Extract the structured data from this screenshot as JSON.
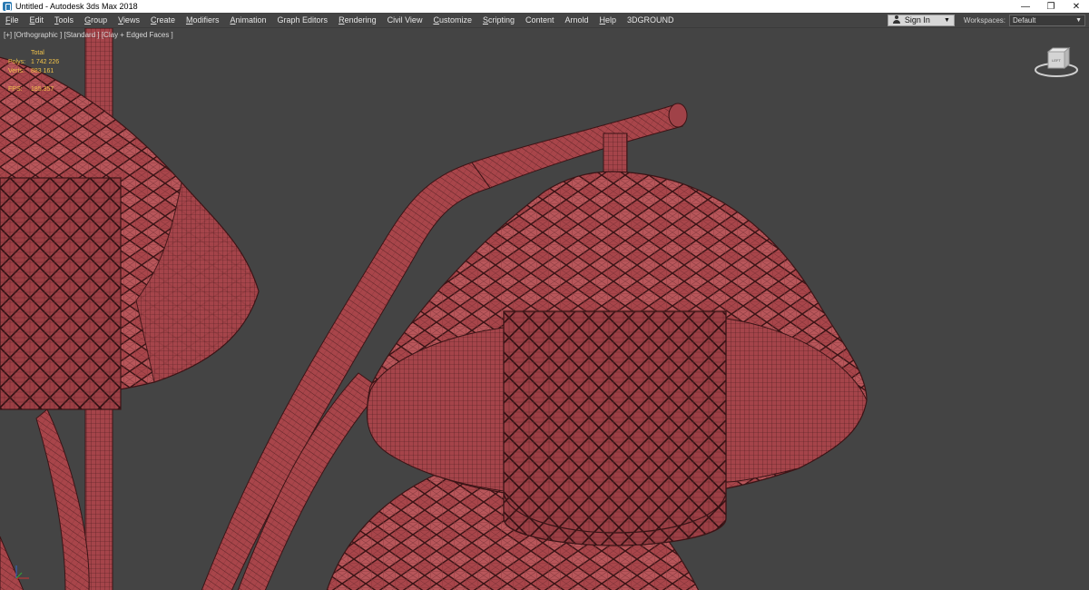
{
  "titlebar": {
    "title": "Untitled - Autodesk 3ds Max 2018",
    "minimize_icon": "—",
    "restore_icon": "❐",
    "close_icon": "✕"
  },
  "menubar": {
    "items": [
      "File",
      "Edit",
      "Tools",
      "Group",
      "Views",
      "Create",
      "Modifiers",
      "Animation",
      "Graph Editors",
      "Rendering",
      "Civil View",
      "Customize",
      "Scripting",
      "Content",
      "Arnold",
      "Help",
      "3DGROUND"
    ],
    "signin_label": "Sign In",
    "workspaces_label": "Workspaces:",
    "workspaces_value": "Default"
  },
  "viewport": {
    "label": "[+] [Orthographic ] [Standard ] [Clay + Edged Faces ]",
    "stats": {
      "total_label": "Total",
      "polys_label": "Polys:",
      "polys_value": "1 742 226",
      "verts_label": "Verts:",
      "verts_value": "883 161",
      "fps_label": "FPS:",
      "fps_value": "185.357"
    },
    "viewcube_label": "LEFT"
  },
  "colors": {
    "viewport_bg": "#444444",
    "mesh_fill": "#a8454a",
    "mesh_edge": "#3b1416",
    "stats_text": "#f0c24a"
  }
}
